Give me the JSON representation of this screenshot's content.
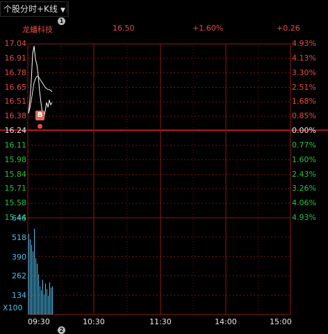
{
  "tab": {
    "label": "个股分时+K线",
    "badge": "1"
  },
  "info": {
    "name": "龙蟠科技",
    "price": "16.50",
    "pct_change": "+1.60%",
    "change": "+0.26"
  },
  "price_axis": {
    "left": [
      "17.04",
      "16.91",
      "16.78",
      "16.65",
      "16.51",
      "16.38",
      "16.24",
      "16.11",
      "15.98",
      "15.84",
      "15.71",
      "15.58",
      "15.44"
    ],
    "right": [
      "4.93%",
      "4.13%",
      "3.30%",
      "2.51%",
      "1.68%",
      "0.85%",
      "0.00%",
      "0.77%",
      "1.60%",
      "2.43%",
      "3.26%",
      "4.06%",
      "4.93%"
    ]
  },
  "volume_axis": {
    "ticks": [
      "646",
      "518",
      "390",
      "262",
      "134"
    ],
    "unit": "X100"
  },
  "time_axis": [
    "09:30",
    "10:30",
    "11:30",
    "14:00",
    "15:00"
  ],
  "signal": {
    "label": "B"
  },
  "bottom_badge": "2",
  "colors": {
    "up": "#e84a4a",
    "down": "#27c43d",
    "grid": "#7a1010",
    "volume": "#49c0f0",
    "price_line": "#ffffff",
    "avg_line": "#e8e8e8"
  },
  "chart_data": {
    "type": "line",
    "title": "",
    "x_label": "",
    "y_label": "",
    "prev_close": 16.24,
    "ylim": [
      15.44,
      17.04
    ],
    "price_series": [
      16.4,
      16.52,
      16.7,
      16.95,
      17.02,
      16.9,
      16.85,
      16.75,
      16.6,
      16.5,
      16.4,
      16.35,
      16.42,
      16.5,
      16.46,
      16.52,
      16.48,
      16.5
    ],
    "avg_series": [
      16.4,
      16.45,
      16.52,
      16.6,
      16.68,
      16.72,
      16.74,
      16.74,
      16.72,
      16.7,
      16.68,
      16.66,
      16.64,
      16.63,
      16.62,
      16.62,
      16.61,
      16.6
    ],
    "volume_series": [
      600,
      560,
      520,
      470,
      640,
      420,
      380,
      300,
      210,
      180,
      260,
      150,
      230,
      190,
      140,
      240,
      200,
      210
    ],
    "volume_ylim": [
      0,
      700
    ]
  }
}
